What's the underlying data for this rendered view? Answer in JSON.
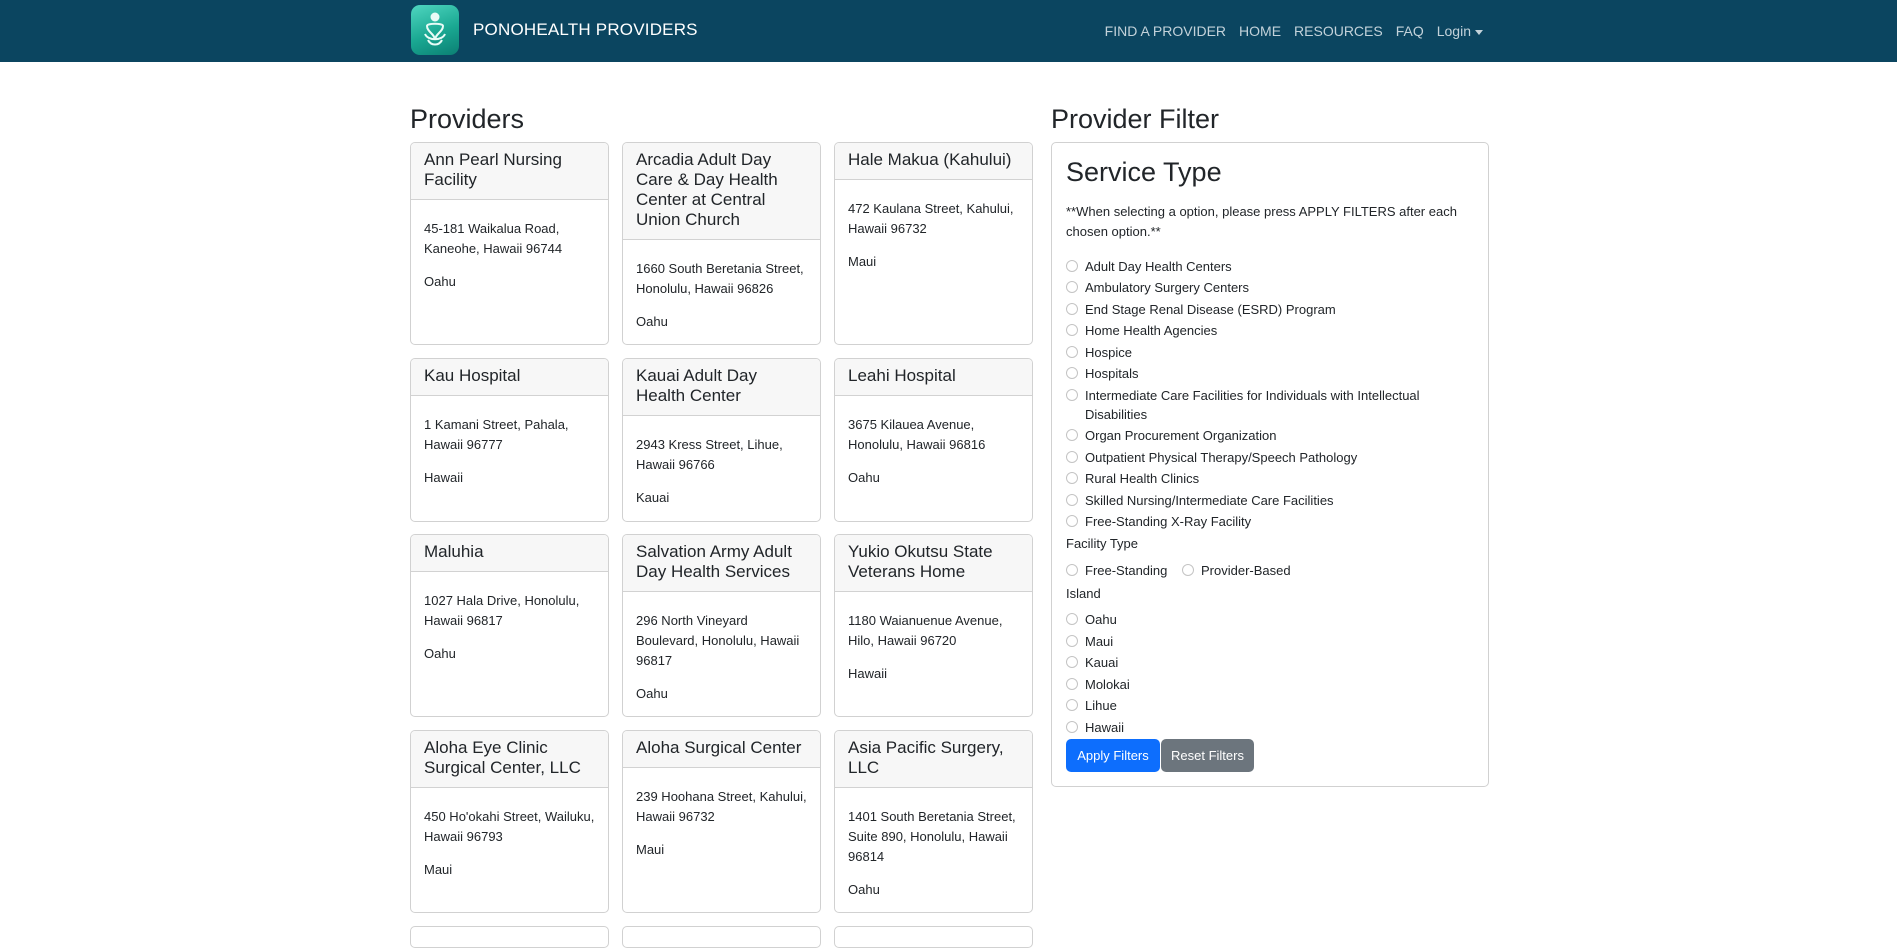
{
  "navbar": {
    "brand": "PONOHEALTH PROVIDERS",
    "links": [
      "FIND A PROVIDER",
      "HOME",
      "RESOURCES",
      "FAQ",
      "Login"
    ]
  },
  "providers_title": "Providers",
  "providers": [
    {
      "name": "Ann Pearl Nursing Facility",
      "address": "45-181 Waikalua Road, Kaneohe, Hawaii 96744",
      "island": "Oahu"
    },
    {
      "name": "Arcadia Adult Day Care & Day Health Center at Central Union Church",
      "address": "1660 South Beretania Street, Honolulu, Hawaii 96826",
      "island": "Oahu"
    },
    {
      "name": "Hale Makua (Kahului)",
      "address": "472 Kaulana Street, Kahului, Hawaii 96732",
      "island": "Maui"
    },
    {
      "name": "Kau Hospital",
      "address": "1 Kamani Street, Pahala, Hawaii 96777",
      "island": "Hawaii"
    },
    {
      "name": "Kauai Adult Day Health Center",
      "address": "2943 Kress Street, Lihue, Hawaii 96766",
      "island": "Kauai"
    },
    {
      "name": "Leahi Hospital",
      "address": "3675 Kilauea Avenue, Honolulu, Hawaii 96816",
      "island": "Oahu"
    },
    {
      "name": "Maluhia",
      "address": "1027 Hala Drive, Honolulu, Hawaii 96817",
      "island": "Oahu"
    },
    {
      "name": "Salvation Army Adult Day Health Services",
      "address": "296 North Vineyard Boulevard, Honolulu, Hawaii 96817",
      "island": "Oahu"
    },
    {
      "name": "Yukio Okutsu State Veterans Home",
      "address": "1180 Waianuenue Avenue, Hilo, Hawaii 96720",
      "island": "Hawaii"
    },
    {
      "name": "Aloha Eye Clinic Surgical Center, LLC",
      "address": "450 Ho'okahi Street, Wailuku, Hawaii 96793",
      "island": "Maui"
    },
    {
      "name": "Aloha Surgical Center",
      "address": "239 Hoohana Street, Kahului, Hawaii 96732",
      "island": "Maui"
    },
    {
      "name": "Asia Pacific Surgery, LLC",
      "address": "1401 South Beretania Street, Suite 890, Honolulu, Hawaii 96814",
      "island": "Oahu"
    }
  ],
  "filter": {
    "title": "Provider Filter",
    "service_title": "Service Type",
    "note": "**When selecting a option, please press APPLY FILTERS after each chosen option.**",
    "service_types": [
      "Adult Day Health Centers",
      "Ambulatory Surgery Centers",
      "End Stage Renal Disease (ESRD) Program",
      "Home Health Agencies",
      "Hospice",
      "Hospitals",
      "Intermediate Care Facilities for Individuals with Intellectual Disabilities",
      "Organ Procurement Organization",
      "Outpatient Physical Therapy/Speech Pathology",
      "Rural Health Clinics",
      "Skilled Nursing/Intermediate Care Facilities",
      "Free-Standing X-Ray Facility"
    ],
    "facility_type_label": "Facility Type",
    "facility_types": [
      "Free-Standing",
      "Provider-Based"
    ],
    "island_label": "Island",
    "islands": [
      "Oahu",
      "Maui",
      "Kauai",
      "Molokai",
      "Lihue",
      "Hawaii"
    ],
    "apply_label": "Apply Filters",
    "reset_label": "Reset Filters"
  }
}
